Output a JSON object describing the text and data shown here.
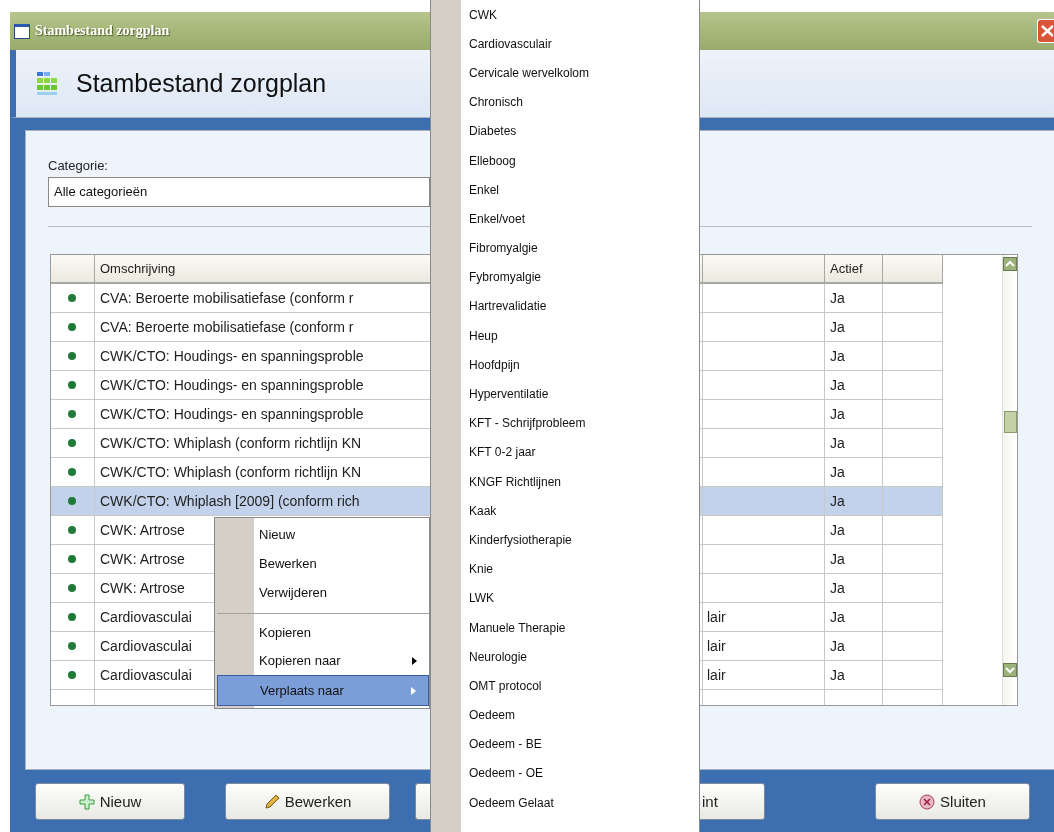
{
  "window": {
    "title": "Stambestand zorgplan"
  },
  "header": {
    "title": "Stambestand zorgplan"
  },
  "category": {
    "label": "Categorie:",
    "value": "Alle categorieën"
  },
  "table": {
    "columns": [
      "Omschrijving",
      "Actief"
    ],
    "rows": [
      {
        "color": "#1f7a3a",
        "omschrijving": "CVA: Beroerte mobilisatiefase (conform r",
        "actief": "Ja",
        "selected": false
      },
      {
        "color": "#1f7a3a",
        "omschrijving": "CVA: Beroerte mobilisatiefase (conform r",
        "actief": "Ja",
        "selected": false
      },
      {
        "color": "#1f7a3a",
        "omschrijving": "CWK/CTO: Houdings- en spanningsproble",
        "actief": "Ja",
        "selected": false
      },
      {
        "color": "#1f7a3a",
        "omschrijving": "CWK/CTO: Houdings- en spanningsproble",
        "actief": "Ja",
        "selected": false
      },
      {
        "color": "#1f7a3a",
        "omschrijving": "CWK/CTO: Houdings- en spanningsproble",
        "actief": "Ja",
        "selected": false
      },
      {
        "color": "#1f7a3a",
        "omschrijving": "CWK/CTO: Whiplash (conform richtlijn KN",
        "actief": "Ja",
        "selected": false
      },
      {
        "color": "#1f7a3a",
        "omschrijving": "CWK/CTO: Whiplash (conform richtlijn KN",
        "actief": "Ja",
        "selected": false
      },
      {
        "color": "#1f7a3a",
        "omschrijving": "CWK/CTO: Whiplash [2009] (conform rich",
        "actief": "Ja",
        "selected": true
      },
      {
        "color": "#1f7a3a",
        "omschrijving": "CWK: Artrose",
        "actief": "Ja",
        "selected": false
      },
      {
        "color": "#1f7a3a",
        "omschrijving": "CWK: Artrose",
        "actief": "Ja",
        "selected": false
      },
      {
        "color": "#1f7a3a",
        "omschrijving": "CWK: Artrose",
        "actief": "Ja",
        "selected": false
      },
      {
        "color": "#1f7a3a",
        "omschrijving": "Cardiovasculai",
        "column_2": "lair",
        "actief": "Ja",
        "selected": false
      },
      {
        "color": "#1f7a3a",
        "omschrijving": "Cardiovasculai",
        "column_2": "lair",
        "actief": "Ja",
        "selected": false
      },
      {
        "color": "#1f7a3a",
        "omschrijving": "Cardiovasculai",
        "column_2": "lair",
        "actief": "Ja",
        "selected": false
      }
    ]
  },
  "context_menu": {
    "items": [
      {
        "label": "Nieuw",
        "separator_before": false,
        "submenu": false,
        "selected": false
      },
      {
        "label": "Bewerken",
        "separator_before": false,
        "submenu": false,
        "selected": false
      },
      {
        "label": "Verwijderen",
        "separator_before": false,
        "submenu": false,
        "selected": false
      },
      {
        "label": "Kopieren",
        "separator_before": true,
        "submenu": false,
        "selected": false
      },
      {
        "label": "Kopieren naar",
        "separator_before": false,
        "submenu": true,
        "selected": false
      },
      {
        "label": "Verplaats naar",
        "separator_before": false,
        "submenu": true,
        "selected": true
      }
    ]
  },
  "submenu": {
    "items": [
      "CWK",
      "Cardiovasculair",
      "Cervicale wervelkolom",
      "Chronisch",
      "Diabetes",
      "Elleboog",
      "Enkel",
      "Enkel/voet",
      "Fibromyalgie",
      "Fybromyalgie",
      "Hartrevalidatie",
      "Heup",
      "Hoofdpijn",
      "Hyperventilatie",
      "KFT - Schrijfprobleem",
      "KFT 0-2 jaar",
      "KNGF Richtlijnen",
      "Kaak",
      "Kinderfysiotherapie",
      "Knie",
      "LWK",
      "Manuele Therapie",
      "Neurologie",
      "OMT protocol",
      "Oedeem",
      "Oedeem - BE",
      "Oedeem - OE",
      "Oedeem Gelaat"
    ]
  },
  "buttons": [
    {
      "kind": "plus",
      "label": "Nieuw"
    },
    {
      "kind": "pencil",
      "label": "Bewerken"
    },
    {
      "kind": "blank"
    },
    {
      "kind": "text",
      "label": "int"
    },
    {
      "kind": "close",
      "label": "Sluiten"
    }
  ]
}
